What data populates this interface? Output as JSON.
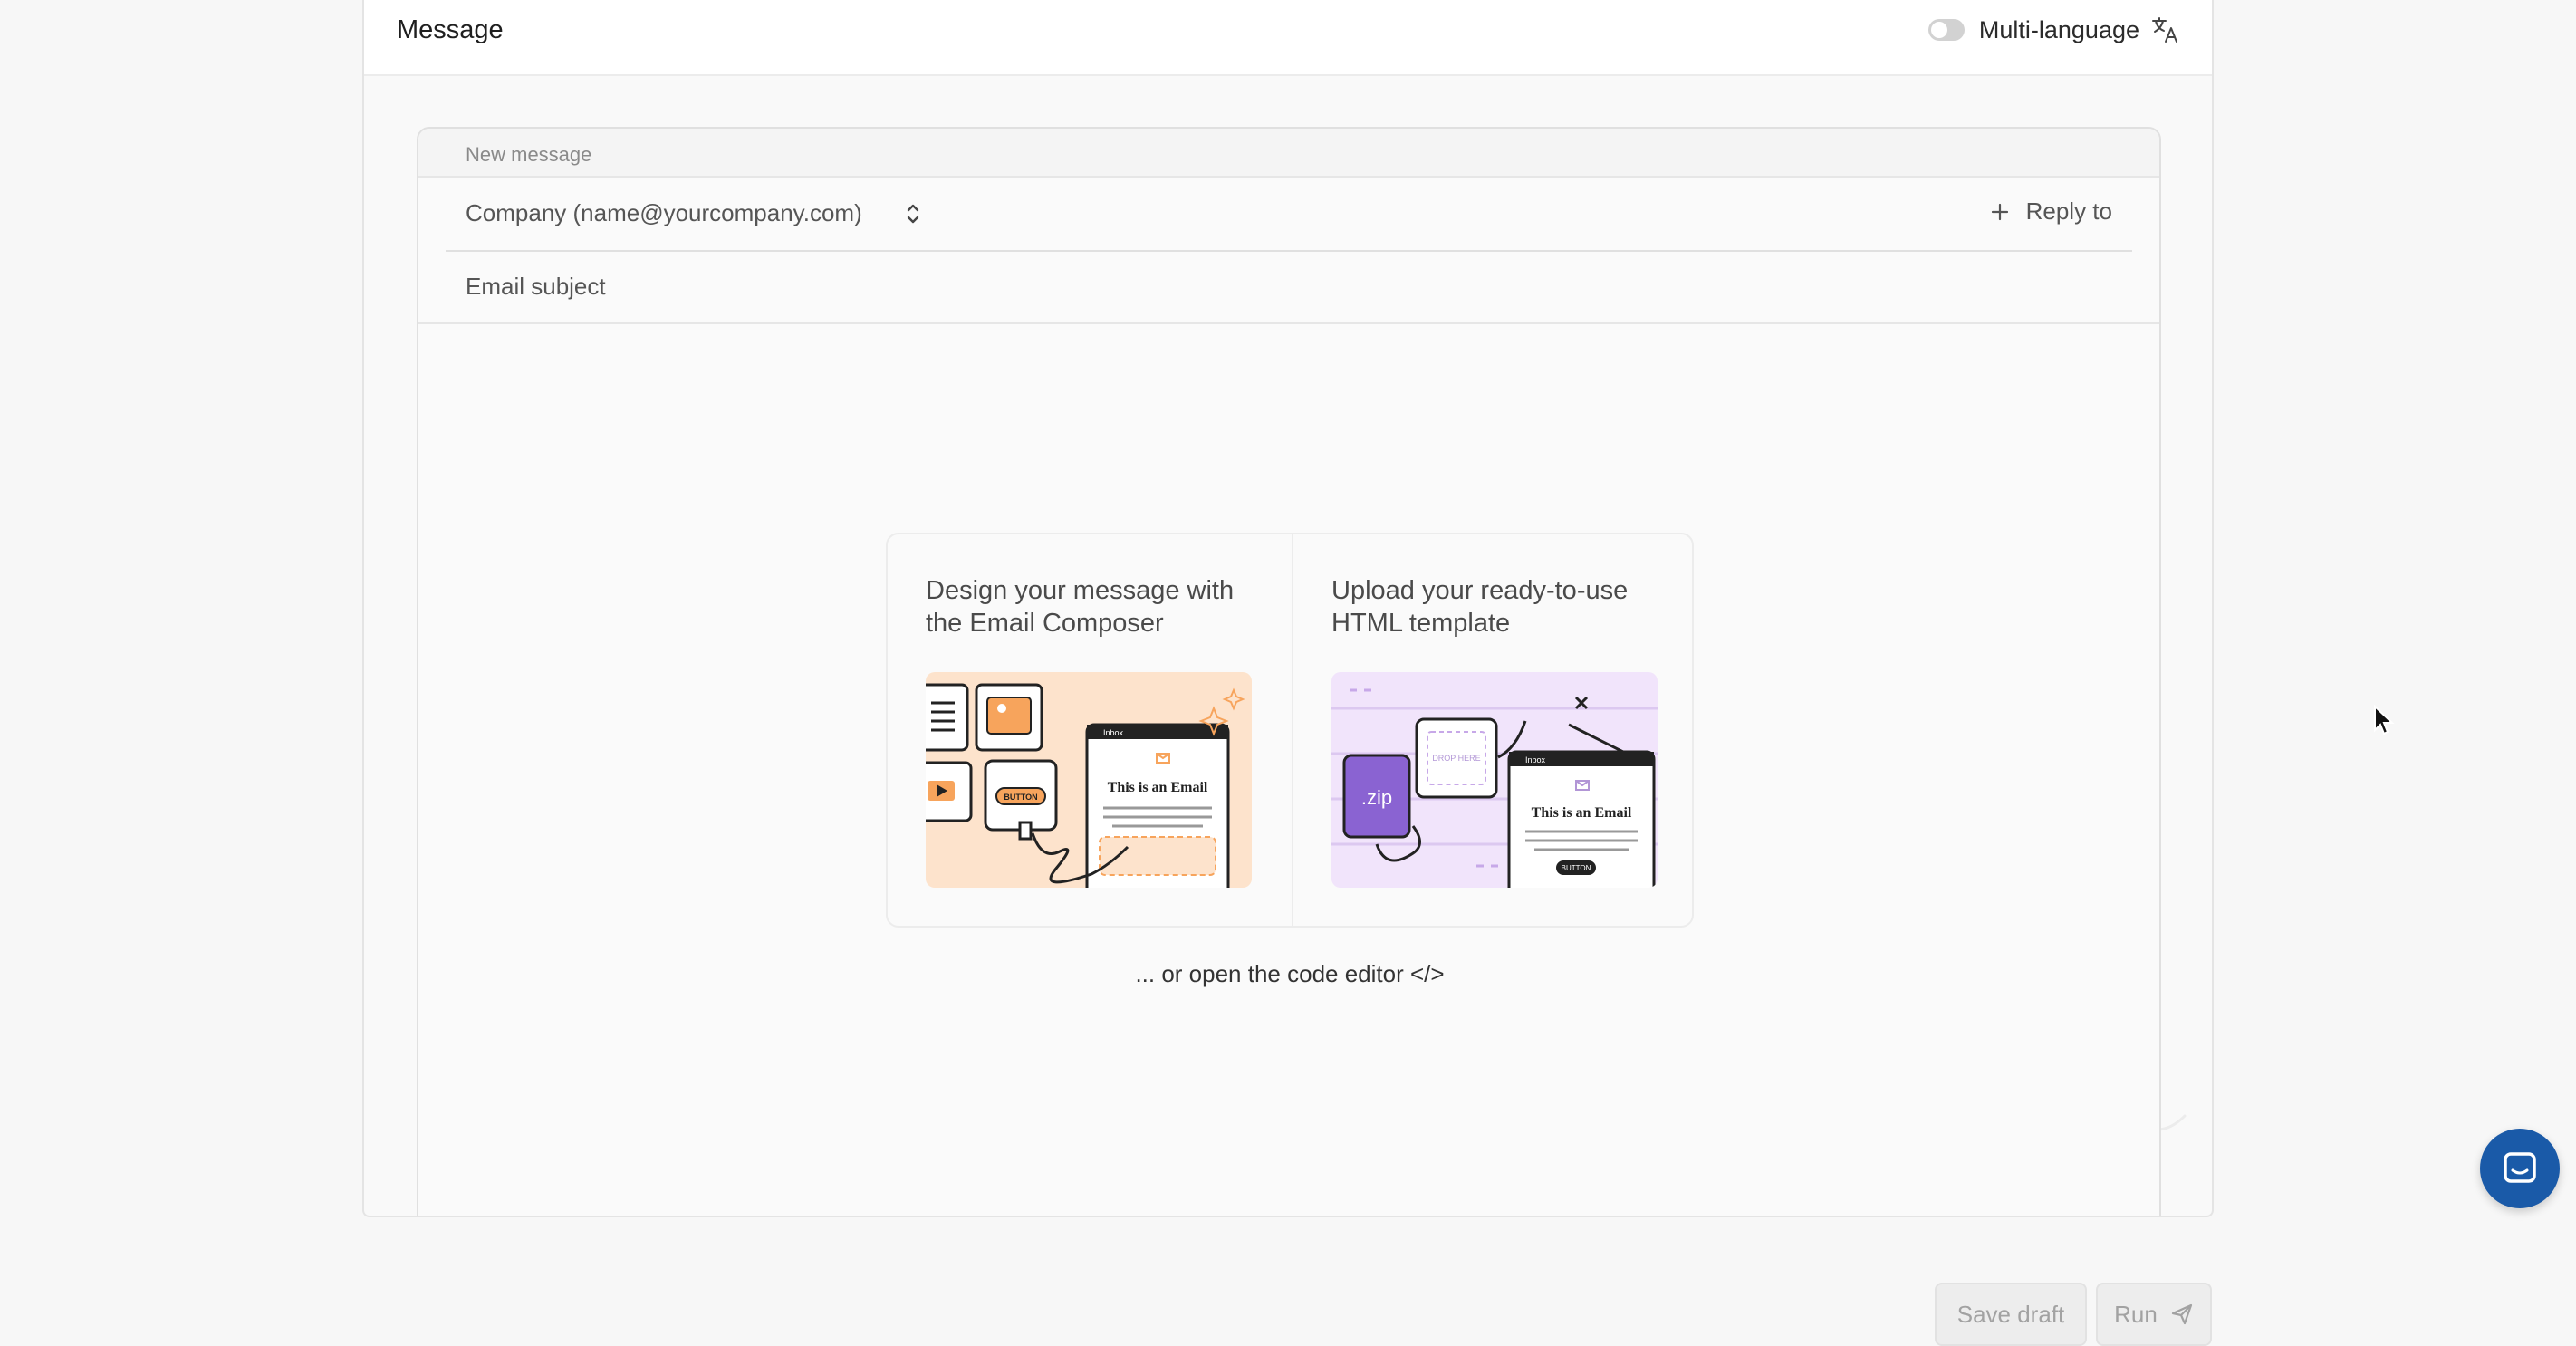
{
  "header": {
    "title": "Message",
    "multi_language_label": "Multi-language",
    "multi_language_enabled": false
  },
  "composer": {
    "label": "New message",
    "sender": "Company (name@yourcompany.com)",
    "reply_to_label": "Reply to",
    "subject_placeholder": "Email subject"
  },
  "options": [
    {
      "title": "Design your message with the Email Composer",
      "illustration_text": "This is an Email",
      "illustration_tab": "Inbox",
      "illustration_button": "BUTTON"
    },
    {
      "title": "Upload your ready-to-use HTML template",
      "illustration_text": "This is an Email",
      "illustration_tab": "Inbox",
      "illustration_button": "BUTTON",
      "zip_label": ".zip",
      "drop_label": "DROP HERE"
    }
  ],
  "code_editor_link": "... or open the code editor </>",
  "actions": {
    "save_draft": "Save draft",
    "run": "Run"
  },
  "colors": {
    "chat_button": "#1a5aa8",
    "composer_illustration_bg": "#fde3cc",
    "upload_illustration_bg": "#f1e4fb",
    "zip_purple": "#8a63d2"
  }
}
